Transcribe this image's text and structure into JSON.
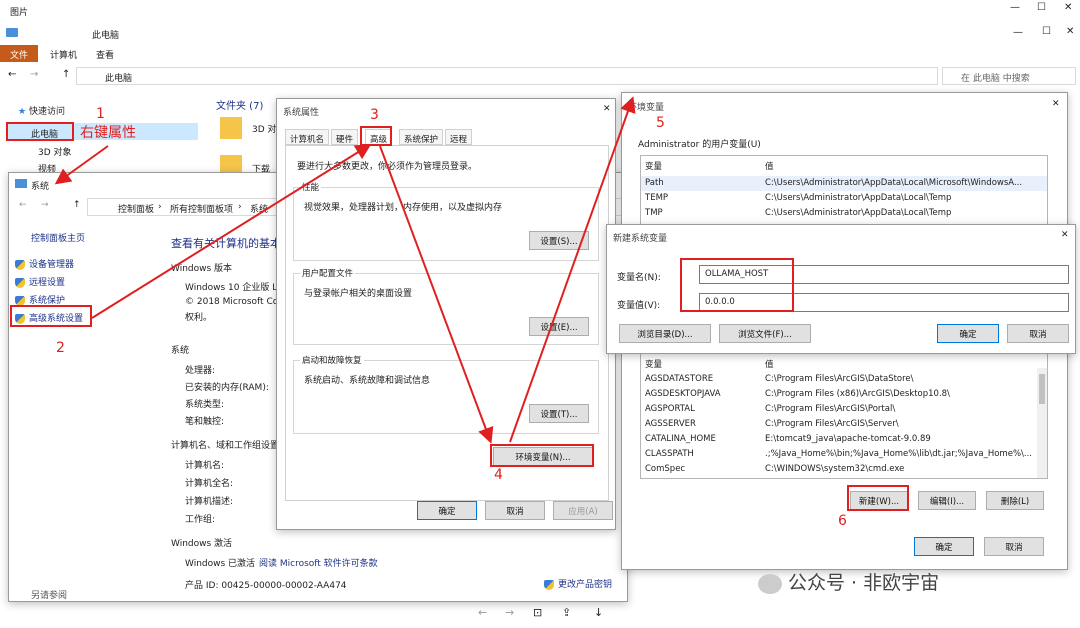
{
  "top": {
    "title": "图片",
    "path_title": "此电脑",
    "ribbon": [
      "文件",
      "计算机",
      "查看"
    ],
    "address": "此电脑",
    "search": "在 此电脑 中搜索",
    "nav": [
      "快速访问",
      "此电脑",
      "3D 对象",
      "视频"
    ],
    "folders_header": "文件夹 (7)",
    "folder_items": [
      "3D 对",
      "下载"
    ]
  },
  "system": {
    "title": "系统",
    "breadcrumb": [
      "控制面板",
      "所有控制面板项",
      "系统"
    ],
    "cp_home": "控制面板主页",
    "links": [
      "设备管理器",
      "远程设置",
      "系统保护",
      "高级系统设置"
    ],
    "heading": "查看有关计算机的基本",
    "win_ver_label": "Windows 版本",
    "win_edition": "Windows 10 企业版 LT",
    "copyright": "© 2018 Microsoft Co",
    "rights": "权利。",
    "sys_label": "系统",
    "sys_rows": [
      "处理器:",
      "已安装的内存(RAM):",
      "系统类型:",
      "笔和触控:"
    ],
    "comp_label": "计算机名、域和工作组设置",
    "comp_rows": [
      "计算机名:",
      "计算机全名:",
      "计算机描述:",
      "工作组:"
    ],
    "activation_label": "Windows 激活",
    "activated": "Windows 已激活",
    "license_link": "阅读 Microsoft 软件许可条款",
    "product_id": "产品 ID: 00425-00000-00002-AA474",
    "change_key": "更改产品密钥",
    "see_also": "另请参阅"
  },
  "sysprops": {
    "title": "系统属性",
    "tabs": [
      "计算机名",
      "硬件",
      "高级",
      "系统保护",
      "远程"
    ],
    "admin_note": "要进行大多数更改，你必须作为管理员登录。",
    "perf_label": "性能",
    "perf_desc": "视觉效果，处理器计划，内存使用，以及虚拟内存",
    "settings_s": "设置(S)...",
    "profile_label": "用户配置文件",
    "profile_desc": "与登录帐户相关的桌面设置",
    "settings_e": "设置(E)...",
    "startup_label": "启动和故障恢复",
    "startup_desc": "系统启动、系统故障和调试信息",
    "settings_t": "设置(T)...",
    "env_button": "环境变量(N)...",
    "ok": "确定",
    "cancel": "取消",
    "apply": "应用(A)"
  },
  "envvars": {
    "title": "环境变量",
    "user_group": "Administrator 的用户变量(U)",
    "col_var": "变量",
    "col_val": "值",
    "user_vars": [
      [
        "Path",
        "C:\\Users\\Administrator\\AppData\\Local\\Microsoft\\WindowsA..."
      ],
      [
        "TEMP",
        "C:\\Users\\Administrator\\AppData\\Local\\Temp"
      ],
      [
        "TMP",
        "C:\\Users\\Administrator\\AppData\\Local\\Temp"
      ]
    ],
    "sys_vars": [
      [
        "AGSDATASTORE",
        "C:\\Program Files\\ArcGIS\\DataStore\\"
      ],
      [
        "AGSDESKTOPJAVA",
        "C:\\Program Files (x86)\\ArcGIS\\Desktop10.8\\"
      ],
      [
        "AGSPORTAL",
        "C:\\Program Files\\ArcGIS\\Portal\\"
      ],
      [
        "AGSSERVER",
        "C:\\Program Files\\ArcGIS\\Server\\"
      ],
      [
        "CATALINA_HOME",
        "E:\\tomcat9_java\\apache-tomcat-9.0.89"
      ],
      [
        "CLASSPATH",
        ".;%Java_Home%\\bin;%Java_Home%\\lib\\dt.jar;%Java_Home%\\..."
      ],
      [
        "ComSpec",
        "C:\\WINDOWS\\system32\\cmd.exe"
      ]
    ],
    "new": "新建(W)...",
    "edit": "编辑(I)...",
    "delete": "删除(L)",
    "ok": "确定",
    "cancel": "取消"
  },
  "newvar": {
    "title": "新建系统变量",
    "name_label": "变量名(N):",
    "name_value": "OLLAMA_HOST",
    "value_label": "变量值(V):",
    "value_value": "0.0.0.0",
    "browse_dir": "浏览目录(D)...",
    "browse_file": "浏览文件(F)...",
    "ok": "确定",
    "cancel": "取消"
  },
  "annotations": {
    "n1": "1",
    "right_prop": "右键属性",
    "n2": "2",
    "n3": "3",
    "n4": "4",
    "n5": "5",
    "n6": "6"
  },
  "watermark": "公众号 · 非欧宇宙"
}
